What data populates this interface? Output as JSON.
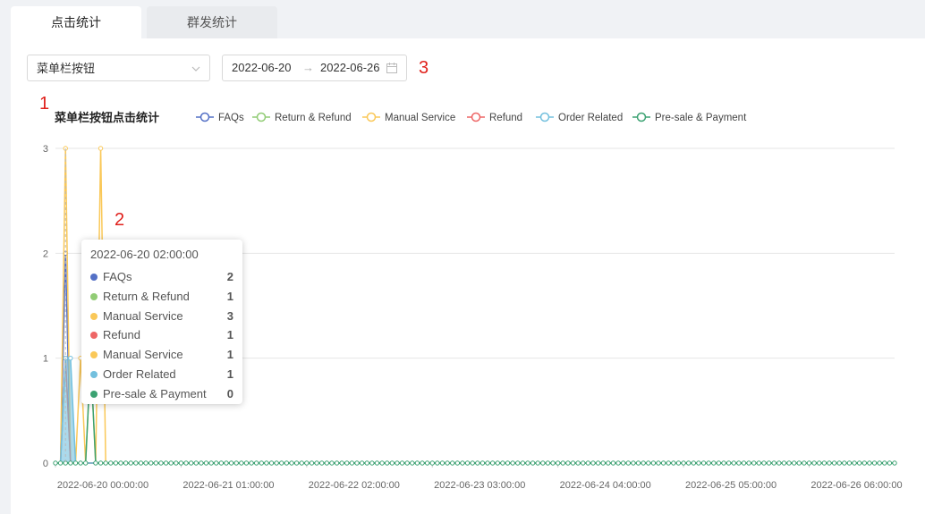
{
  "tabs": [
    {
      "label": "点击统计",
      "active": true
    },
    {
      "label": "群发统计",
      "active": false
    }
  ],
  "filter": {
    "select_value": "菜单栏按钮",
    "date_start": "2022-06-20",
    "date_separator": "→",
    "date_end": "2022-06-26"
  },
  "annotations": {
    "a1": "1",
    "a2": "2",
    "a3": "3"
  },
  "tooltip": {
    "title": "2022-06-20 02:00:00",
    "rows": [
      {
        "name": "FAQs",
        "value": "2",
        "color": "#5470c6"
      },
      {
        "name": "Return & Refund",
        "value": "1",
        "color": "#91cc75"
      },
      {
        "name": "Manual Service",
        "value": "3",
        "color": "#fac858"
      },
      {
        "name": "Refund",
        "value": "1",
        "color": "#ee6666"
      },
      {
        "name": "Manual Service",
        "value": "1",
        "color": "#fac858"
      },
      {
        "name": "Order Related",
        "value": "1",
        "color": "#73c0de"
      },
      {
        "name": "Pre-sale & Payment",
        "value": "0",
        "color": "#3ba272"
      }
    ]
  },
  "chart_data": {
    "type": "line",
    "title": "菜单栏按钮点击统计",
    "legend_position": "top",
    "grid": true,
    "ylim": [
      0,
      3
    ],
    "yticks": [
      "0",
      "1",
      "2",
      "3"
    ],
    "xticks": [
      "2022-06-20 00:00:00",
      "2022-06-21 01:00:00",
      "2022-06-22 02:00:00",
      "2022-06-23 03:00:00",
      "2022-06-24 04:00:00",
      "2022-06-25 05:00:00",
      "2022-06-26 06:00:00"
    ],
    "x_start": "2022-06-20 00:00:00",
    "x_end": "2022-06-26 23:00:00",
    "x_step": "1 hour",
    "series": [
      {
        "name": "FAQs",
        "color": "#5470c6",
        "points": [
          [
            0,
            0
          ],
          [
            1,
            0
          ],
          [
            2,
            2
          ],
          [
            3,
            0
          ]
        ]
      },
      {
        "name": "Return & Refund",
        "color": "#91cc75",
        "points": [
          [
            0,
            0
          ],
          [
            1,
            0
          ],
          [
            2,
            1
          ],
          [
            3,
            0
          ]
        ]
      },
      {
        "name": "Manual Service",
        "color": "#fac858",
        "points": [
          [
            0,
            0
          ],
          [
            1,
            0
          ],
          [
            2,
            3
          ],
          [
            3,
            0
          ],
          [
            4,
            0
          ],
          [
            5,
            1
          ],
          [
            6,
            0
          ],
          [
            7,
            1
          ],
          [
            8,
            0
          ],
          [
            9,
            3
          ],
          [
            10,
            0
          ]
        ]
      },
      {
        "name": "Refund",
        "color": "#ee6666",
        "points": [
          [
            0,
            0
          ],
          [
            1,
            0
          ],
          [
            2,
            1
          ],
          [
            3,
            0
          ]
        ]
      },
      {
        "name": "Order Related",
        "color": "#73c0de",
        "points": [
          [
            0,
            0
          ],
          [
            1,
            0
          ],
          [
            2,
            1
          ],
          [
            3,
            1
          ],
          [
            4,
            0
          ]
        ]
      },
      {
        "name": "Pre-sale & Payment",
        "color": "#3ba272",
        "points": [
          [
            0,
            0
          ],
          [
            1,
            0
          ],
          [
            2,
            0
          ],
          [
            3,
            0
          ],
          [
            4,
            0
          ],
          [
            5,
            0
          ],
          [
            6,
            0
          ],
          [
            7,
            1
          ],
          [
            8,
            0
          ]
        ]
      }
    ]
  }
}
